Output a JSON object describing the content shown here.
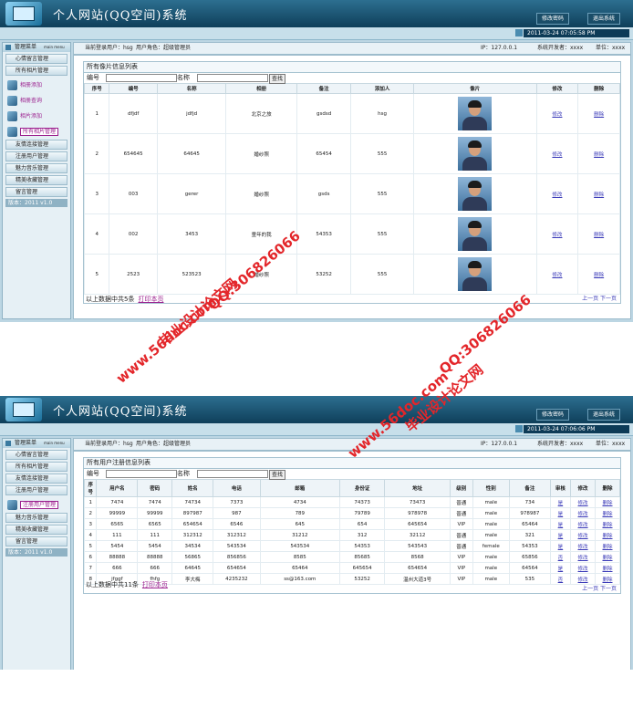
{
  "header": {
    "title": "个人网站(QQ空间)系统",
    "change_password": "修改密码",
    "logout": "退出系统"
  },
  "panels": [
    {
      "clock": "2011-03-24 07:05:58 PM",
      "sidebar": {
        "title": "管理菜单",
        "title_en": "main menu",
        "top_items": [
          "心情留言管理",
          "所有相片管理"
        ],
        "pic_items": [
          "相册添加",
          "相册查询",
          "相片添加",
          "所有相片管理"
        ],
        "active_pic": 3,
        "bottom_items": [
          "友情连接管理",
          "注册用户管理",
          "魅力音乐管理",
          "精美收藏管理",
          "留言管理"
        ],
        "version": "版本：2011 v1.0"
      },
      "infobar": {
        "user": "当前登录用户：hsg",
        "role": "用户角色：超级管理员",
        "ip": "IP：127.0.0.1",
        "developer": "系统开发者：xxxx",
        "unit": "单位：xxxx"
      },
      "box_title": "所有像片信息列表",
      "search": {
        "id_label": "编号",
        "name_label": "名称",
        "button": "查找"
      },
      "columns": [
        "序号",
        "编号",
        "名称",
        "相册",
        "备注",
        "添加人",
        "像片",
        "修改",
        "删除"
      ],
      "rows": [
        [
          "1",
          "dfjdf",
          "jdfjd",
          "北京之旅",
          "gsdsd",
          "hsg",
          "",
          "修改",
          "删除"
        ],
        [
          "2",
          "654645",
          "64645",
          "婚纱照",
          "65454",
          "555",
          "",
          "修改",
          "删除"
        ],
        [
          "3",
          "003",
          "gerer",
          "婚纱照",
          "gsds",
          "555",
          "",
          "修改",
          "删除"
        ],
        [
          "4",
          "002",
          "3453",
          "童年的我",
          "54353",
          "555",
          "",
          "修改",
          "删除"
        ],
        [
          "5",
          "2523",
          "523523",
          "婚纱照",
          "53252",
          "555",
          "",
          "修改",
          "删除"
        ]
      ],
      "pager": "上一页  下一页",
      "footer": "以上数据中共5条",
      "print": "打印本页"
    },
    {
      "clock": "2011-03-24 07:06:06 PM",
      "sidebar": {
        "title": "管理菜单",
        "title_en": "main menu",
        "top_items": [
          "心情留言管理",
          "所有相片管理",
          "友情连接管理",
          "注册用户管理"
        ],
        "pic_items": [
          "注册用户管理"
        ],
        "active_pic": 0,
        "bottom_items": [
          "魅力音乐管理",
          "精美收藏管理",
          "留言管理"
        ],
        "version": "版本：2011 v1.0"
      },
      "infobar": {
        "user": "当前登录用户：hsg",
        "role": "用户角色：超级管理员",
        "ip": "IP：127.0.0.1",
        "developer": "系统开发者：xxxx",
        "unit": "单位：xxxx"
      },
      "box_title": "所有用户注册信息列表",
      "search": {
        "id_label": "编号",
        "name_label": "名称",
        "button": "查找"
      },
      "columns": [
        "序号",
        "用户名",
        "密码",
        "姓名",
        "电话",
        "邮箱",
        "身份证",
        "地址",
        "级别",
        "性别",
        "备注",
        "审核",
        "修改",
        "删除"
      ],
      "rows": [
        [
          "1",
          "7474",
          "7474",
          "74734",
          "7373",
          "4734",
          "74373",
          "73473",
          "普通",
          "male",
          "734",
          "是",
          "修改",
          "删除"
        ],
        [
          "2",
          "99999",
          "99999",
          "897987",
          "987",
          "789",
          "79789",
          "978978",
          "普通",
          "male",
          "978987",
          "是",
          "修改",
          "删除"
        ],
        [
          "3",
          "6565",
          "6565",
          "654654",
          "6546",
          "645",
          "654",
          "645654",
          "VIP",
          "male",
          "65464",
          "是",
          "修改",
          "删除"
        ],
        [
          "4",
          "111",
          "111",
          "312312",
          "312312",
          "31212",
          "312",
          "32112",
          "普通",
          "male",
          "321",
          "是",
          "修改",
          "删除"
        ],
        [
          "5",
          "5454",
          "5454",
          "34534",
          "543534",
          "543534",
          "54353",
          "543543",
          "普通",
          "female",
          "54353",
          "是",
          "修改",
          "删除"
        ],
        [
          "6",
          "88888",
          "88888",
          "56865",
          "856856",
          "8585",
          "85685",
          "8568",
          "VIP",
          "male",
          "65856",
          "否",
          "修改",
          "删除"
        ],
        [
          "7",
          "666",
          "666",
          "64645",
          "654654",
          "65464",
          "645654",
          "654654",
          "VIP",
          "male",
          "64564",
          "是",
          "修改",
          "删除"
        ],
        [
          "8",
          "jfggf",
          "fhfg",
          "李大梅",
          "4235232",
          "ss@163.com",
          "53252",
          "温州大道3号",
          "VIP",
          "male",
          "535",
          "否",
          "修改",
          "删除"
        ]
      ],
      "pager": "上一页  下一页",
      "footer": "以上数据中共11条",
      "print": "打印本页"
    }
  ],
  "watermarks": {
    "site": "www.56doc.com",
    "brand": "毕业设计论文网",
    "qq": "QQ:306826066"
  }
}
